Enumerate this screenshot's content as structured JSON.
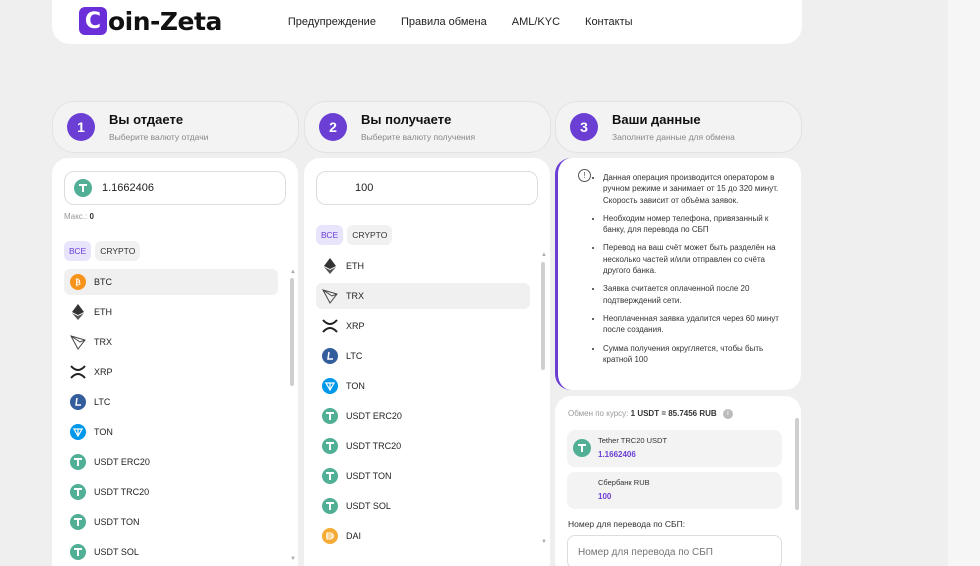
{
  "logo": {
    "mark": "C",
    "text": "oin-Zeta"
  },
  "nav": [
    "Предупреждение",
    "Правила обмена",
    "AML/KYC",
    "Контакты"
  ],
  "steps": [
    {
      "num": "1",
      "title": "Вы отдаете",
      "subtitle": "Выберите валюту отдачи"
    },
    {
      "num": "2",
      "title": "Вы получаете",
      "subtitle": "Выберите валюту получения"
    },
    {
      "num": "3",
      "title": "Ваши данные",
      "subtitle": "Заполните данные для обмена"
    }
  ],
  "give": {
    "amount": "1.1662406",
    "max_label": "Макс.",
    "max_value": "0",
    "filters": [
      "ВСЕ",
      "CRYPTO"
    ],
    "list": [
      "BTC",
      "ETH",
      "TRX",
      "XRP",
      "LTC",
      "TON",
      "USDT ERC20",
      "USDT TRC20",
      "USDT TON",
      "USDT SOL"
    ]
  },
  "receive": {
    "amount": "100",
    "filters": [
      "ВСЕ",
      "CRYPTO"
    ],
    "list": [
      "ETH",
      "TRX",
      "XRP",
      "LTC",
      "TON",
      "USDT ERC20",
      "USDT TRC20",
      "USDT TON",
      "USDT SOL",
      "DAI"
    ]
  },
  "info": {
    "icon": "!",
    "items": [
      "Данная операция производится оператором в ручном режиме и занимает от 15 до 320 минут. Скорость зависит от объёма заявок.",
      "Необходим номер телефона, привязанный к банку, для перевода по СБП",
      "Перевод на ваш счёт может быть разделён на несколько частей и/или отправлен со счёта другого банка.",
      "Заявка считается оплаченной после 20 подтверждений сети.",
      "Неоплаченная заявка удалится через 60 минут после создания.",
      "Сумма получения округляется, чтобы быть кратной 100"
    ]
  },
  "exchange": {
    "rate_label": "Обмен по курсу:",
    "rate_value": "1 USDT = 85.7456 RUB",
    "rate_icon": "i",
    "from_label": "Tether TRC20 USDT",
    "from_value": "1.1662406",
    "to_label": "Сбербанк RUB",
    "to_value": "100",
    "sbp_label": "Номер для перевода по СБП:",
    "sbp_placeholder": "Номер для перевода по СБП"
  },
  "colors": {
    "accent": "#6b3fd4",
    "usdt": "#50af95",
    "btc": "#f7931a",
    "ltc": "#345d9d",
    "ton": "#0098ea",
    "dai": "#f5ac37"
  }
}
